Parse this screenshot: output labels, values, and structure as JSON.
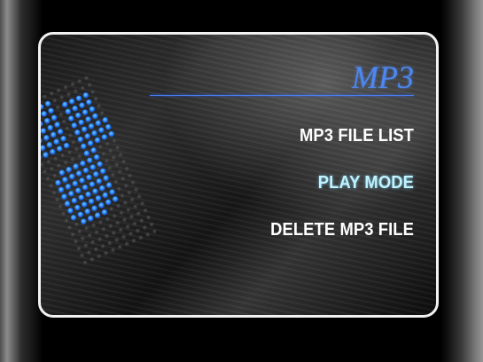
{
  "screen": {
    "title": "MP3",
    "accent_color": "#4d88f2",
    "selected_color": "#bff3ff"
  },
  "menu": {
    "items": [
      {
        "label": "MP3 FILE LIST",
        "selected": false
      },
      {
        "label": "PLAY MODE",
        "selected": true
      },
      {
        "label": "DELETE MP3 FILE",
        "selected": false
      }
    ]
  }
}
